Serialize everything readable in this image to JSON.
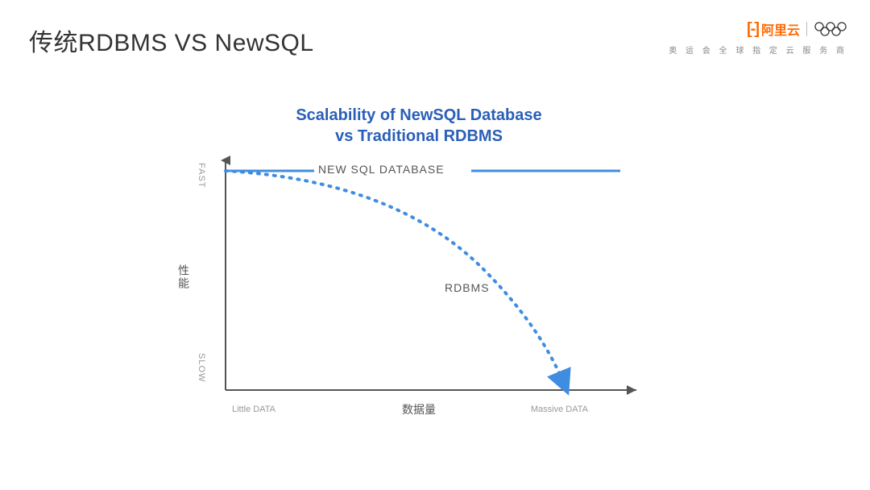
{
  "slide": {
    "title": "传统RDBMS VS NewSQL"
  },
  "branding": {
    "logo_text": "阿里云",
    "tagline": "奥 运 会 全 球 指 定 云 服 务 商"
  },
  "chart": {
    "title_line1": "Scalability of NewSQL Database",
    "title_line2": "vs Traditional RDBMS",
    "y_axis_label": "性能",
    "y_tick_top": "FAST",
    "y_tick_bottom": "SLOW",
    "x_axis_label": "数据量",
    "x_tick_left": "Little DATA",
    "x_tick_right": "Massive DATA",
    "series_newsql_label": "NEW SQL DATABASE",
    "series_rdbms_label": "RDBMS",
    "color_newsql": "#3f8de0",
    "color_rdbms": "#3f8de0"
  },
  "chart_data": {
    "type": "line",
    "title": "Scalability of NewSQL Database vs Traditional RDBMS",
    "xlabel": "数据量",
    "ylabel": "性能",
    "x_range_labels": [
      "Little DATA",
      "Massive DATA"
    ],
    "y_range_labels": [
      "SLOW",
      "FAST"
    ],
    "series": [
      {
        "name": "NEW SQL DATABASE",
        "style": "solid",
        "x": [
          0,
          0.25,
          0.5,
          0.75,
          1.0
        ],
        "y": [
          0.95,
          0.95,
          0.95,
          0.95,
          0.95
        ]
      },
      {
        "name": "RDBMS",
        "style": "dotted",
        "x": [
          0,
          0.15,
          0.3,
          0.45,
          0.6,
          0.72,
          0.8,
          0.86
        ],
        "y": [
          0.95,
          0.94,
          0.91,
          0.85,
          0.72,
          0.5,
          0.25,
          0.02
        ]
      }
    ],
    "xlim": [
      0,
      1
    ],
    "ylim": [
      0,
      1
    ]
  }
}
